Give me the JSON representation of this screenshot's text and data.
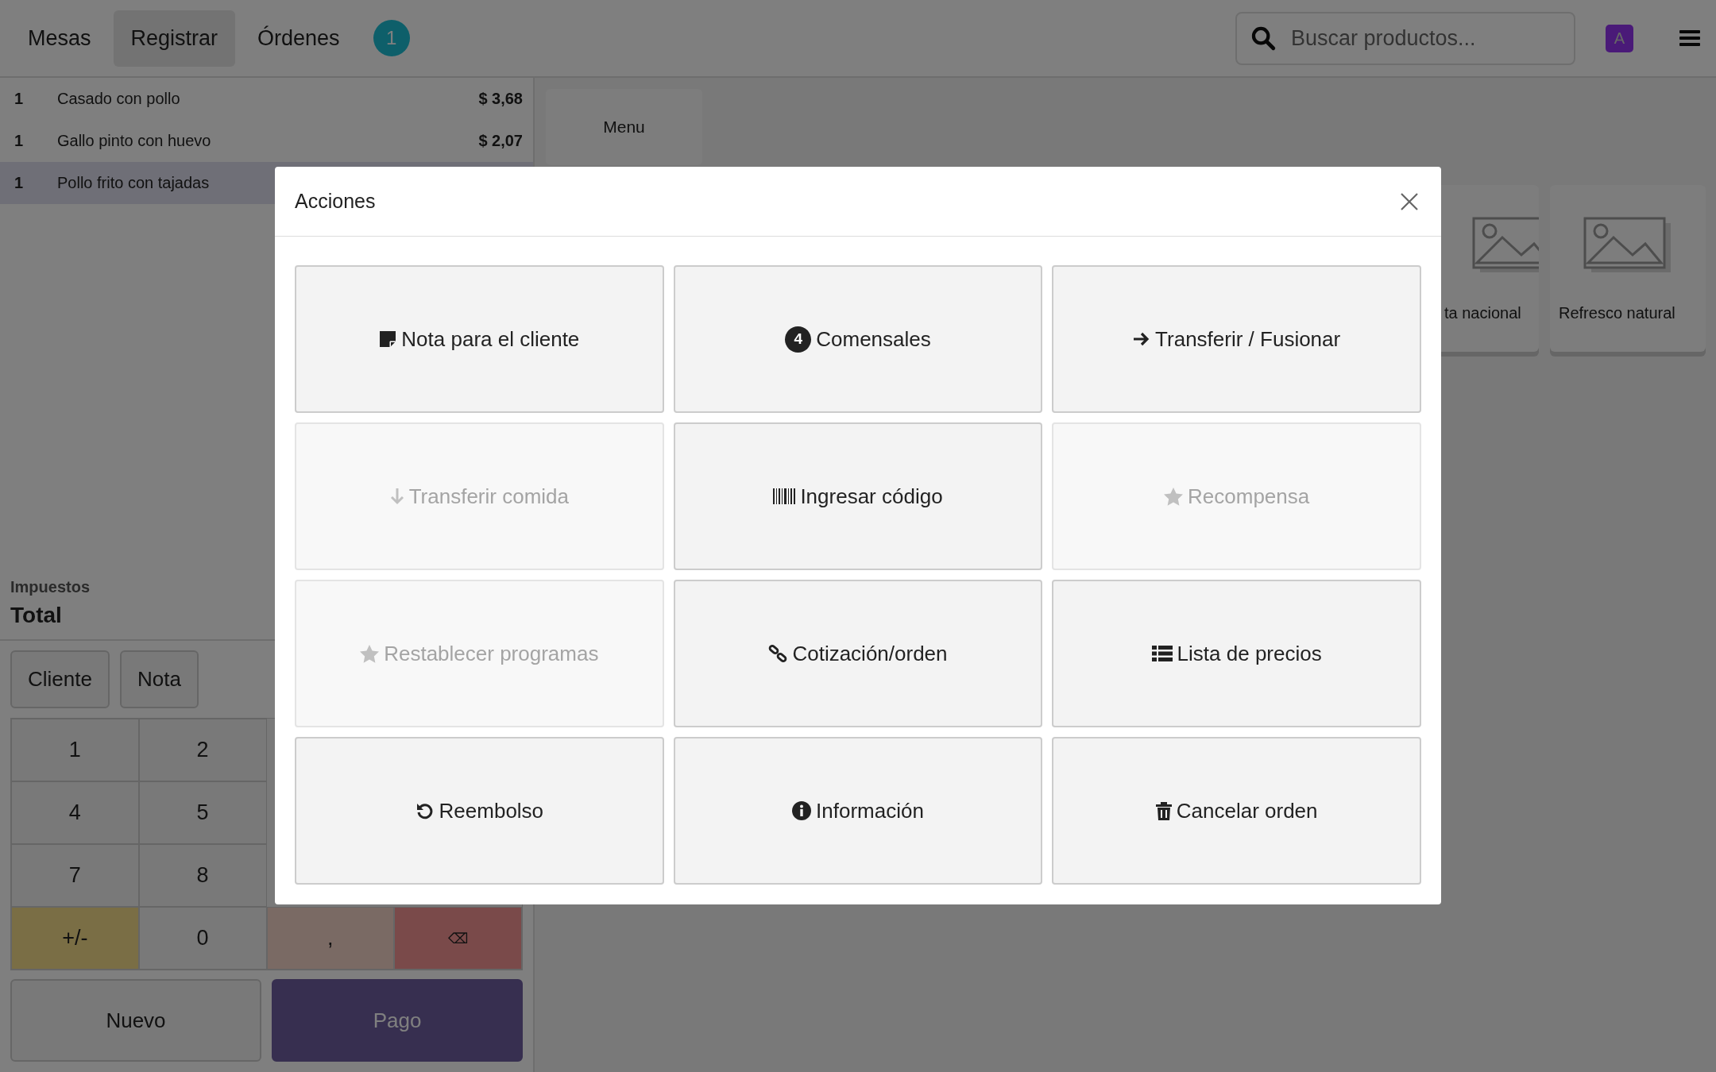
{
  "navbar": {
    "tabs": [
      {
        "label": "Mesas",
        "selected": false
      },
      {
        "label": "Registrar",
        "selected": true
      },
      {
        "label": "Órdenes",
        "selected": false
      }
    ],
    "orders_badge": "1",
    "search": {
      "placeholder": "Buscar productos..."
    },
    "avatar": "A"
  },
  "order_lines": [
    {
      "qty": "1",
      "name": "Casado con pollo",
      "price": "$ 3,68",
      "selected": false
    },
    {
      "qty": "1",
      "name": "Gallo pinto con huevo",
      "price": "$ 2,07",
      "selected": false
    },
    {
      "qty": "1",
      "name": "Pollo frito con tajadas",
      "selected": true
    }
  ],
  "summary": {
    "taxes_label": "Impuestos",
    "total_label": "Total"
  },
  "control_buttons": [
    "Cliente",
    "Nota"
  ],
  "numpad": [
    [
      {
        "label": "1",
        "kind": "digit"
      },
      {
        "label": "2",
        "kind": "digit"
      }
    ],
    [
      {
        "label": "4",
        "kind": "digit"
      },
      {
        "label": "5",
        "kind": "digit"
      }
    ],
    [
      {
        "label": "7",
        "kind": "digit"
      },
      {
        "label": "8",
        "kind": "digit"
      }
    ],
    [
      {
        "label": "+/-",
        "kind": "sign"
      },
      {
        "label": "0",
        "kind": "digit"
      },
      {
        "label": ",",
        "kind": "decimal"
      },
      {
        "label": "⌫",
        "kind": "backspace"
      }
    ]
  ],
  "action_buttons": [
    {
      "label": "Nuevo",
      "kind": "secondary"
    },
    {
      "label": "Pago",
      "kind": "primary"
    }
  ],
  "categories": [
    "Menu"
  ],
  "products": [
    {
      "name": "ta nacional",
      "cut_off": true
    },
    {
      "name": "Refresco natural",
      "cut_off": false
    }
  ],
  "dialog": {
    "title": "Acciones",
    "buttons": [
      {
        "label": "Nota para el cliente",
        "disabled": false
      },
      {
        "label": "Comensales",
        "badge": "4",
        "disabled": false
      },
      {
        "label": "Transferir / Fusionar",
        "disabled": false
      },
      {
        "label": "Transferir comida",
        "disabled": true
      },
      {
        "label": "Ingresar código",
        "disabled": false
      },
      {
        "label": "Recompensa",
        "disabled": true
      },
      {
        "label": "Restablecer programas",
        "disabled": true
      },
      {
        "label": "Cotización/orden",
        "disabled": false
      },
      {
        "label": "Lista de precios",
        "disabled": false
      },
      {
        "label": "Reembolso",
        "disabled": false
      },
      {
        "label": "Información",
        "disabled": false
      },
      {
        "label": "Cancelar orden",
        "disabled": false
      }
    ]
  }
}
